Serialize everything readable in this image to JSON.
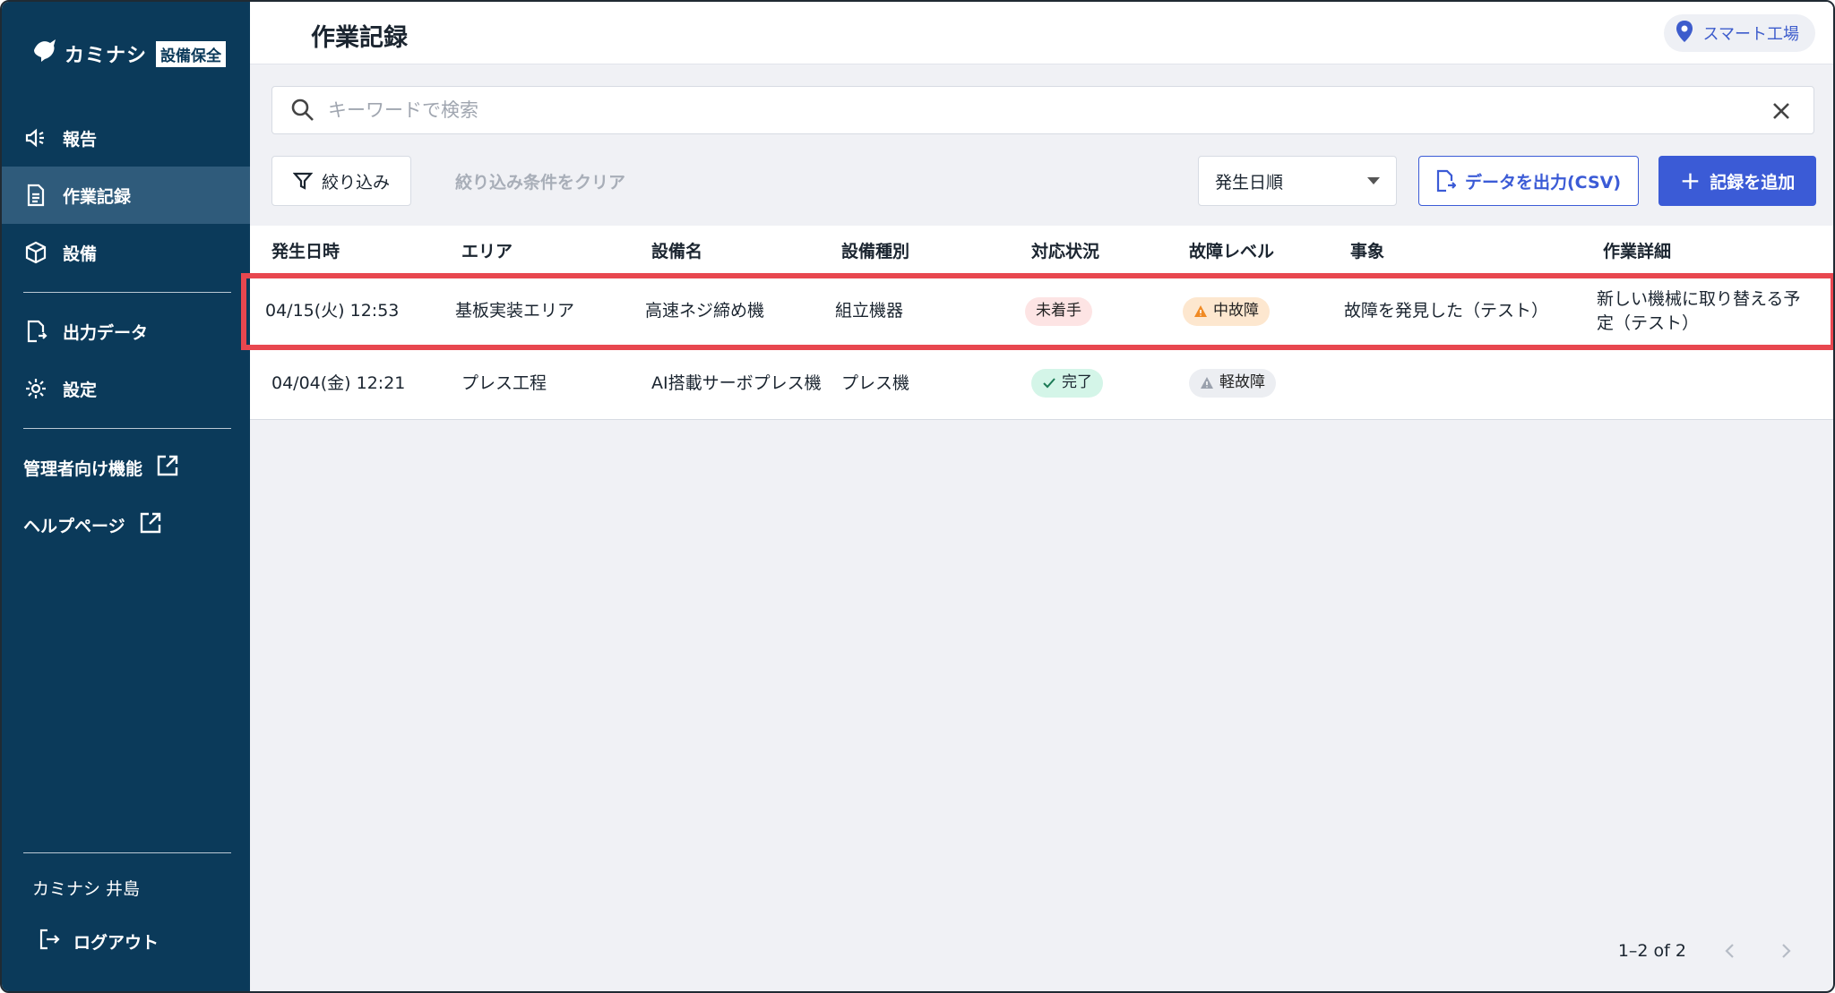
{
  "app": {
    "logo_text": "カミナシ",
    "logo_badge": "設備保全"
  },
  "sidebar": {
    "items": [
      {
        "label": "報告",
        "icon": "megaphone-icon"
      },
      {
        "label": "作業記録",
        "icon": "document-icon",
        "active": true
      },
      {
        "label": "設備",
        "icon": "cube-icon"
      },
      {
        "label": "出力データ",
        "icon": "export-file-icon"
      },
      {
        "label": "設定",
        "icon": "gear-icon"
      }
    ],
    "external_links": [
      {
        "label": "管理者向け機能",
        "icon": "external-link-icon"
      },
      {
        "label": "ヘルプページ",
        "icon": "external-link-icon"
      }
    ],
    "user_name": "カミナシ 井島",
    "logout_label": "ログアウト"
  },
  "header": {
    "title": "作業記録",
    "location": "スマート工場"
  },
  "search": {
    "placeholder": "キーワードで検索",
    "value": ""
  },
  "toolbar": {
    "filter_label": "絞り込み",
    "clear_filter_label": "絞り込み条件をクリア",
    "sort_value": "発生日順",
    "csv_label": "データを出力(CSV)",
    "add_label": "記録を追加"
  },
  "table": {
    "columns": [
      "発生日時",
      "エリア",
      "設備名",
      "設備種別",
      "対応状況",
      "故障レベル",
      "事象",
      "作業詳細"
    ],
    "rows": [
      {
        "datetime": "04/15(火) 12:53",
        "area": "基板実装エリア",
        "equipment": "高速ネジ締め機",
        "type": "組立機器",
        "status": "未着手",
        "level": "中故障",
        "event": "故障を発見した（テスト）",
        "detail": "新しい機械に取り替える予定（テスト）"
      },
      {
        "datetime": "04/04(金) 12:21",
        "area": "プレス工程",
        "equipment": "AI搭載サーボプレス機",
        "type": "プレス機",
        "status": "完了",
        "level": "軽故障",
        "event": "",
        "detail": ""
      }
    ]
  },
  "pagination": {
    "range": "1–2 of 2"
  },
  "colors": {
    "sidebar_bg": "#0b3a5a",
    "sidebar_active": "#2f5b7b",
    "accent": "#3b5bd6",
    "highlight": "#e8474f",
    "status_pending_bg": "#fde4e4",
    "status_done_bg": "#d4f5e8",
    "level_mid_bg": "#fde7cf",
    "level_light_bg": "#eceef2"
  }
}
